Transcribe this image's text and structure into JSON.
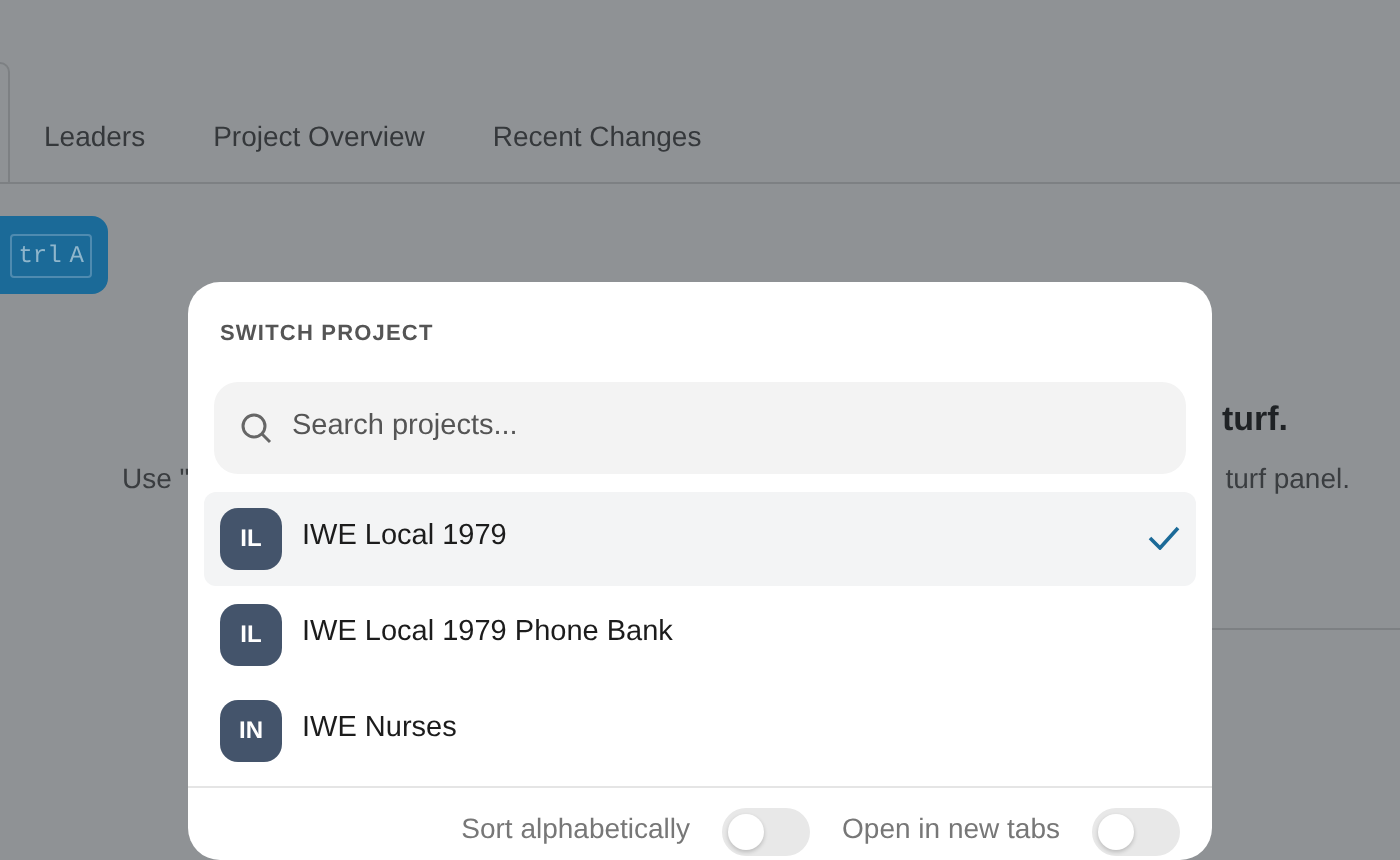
{
  "background": {
    "tabs": [
      {
        "label": "Leaders",
        "selected": false
      },
      {
        "label": "Project Overview",
        "selected": false
      },
      {
        "label": "Recent Changes",
        "selected": false
      }
    ],
    "shortcut_keys": [
      "trl",
      "A"
    ],
    "empty_state": {
      "title_end": "turf.",
      "text_start": "Use \"",
      "text_end": "turf panel."
    }
  },
  "modal": {
    "title": "SWITCH PROJECT",
    "search": {
      "placeholder": "Search projects..."
    },
    "projects": [
      {
        "initials": "IL",
        "name": "IWE Local 1979",
        "selected": true
      },
      {
        "initials": "IL",
        "name": "IWE Local 1979 Phone Bank",
        "selected": false
      },
      {
        "initials": "IN",
        "name": "IWE Nurses",
        "selected": false
      }
    ],
    "options": [
      {
        "label": "Sort alphabetically",
        "on": false
      },
      {
        "label": "Open in new tabs",
        "on": false
      }
    ]
  }
}
